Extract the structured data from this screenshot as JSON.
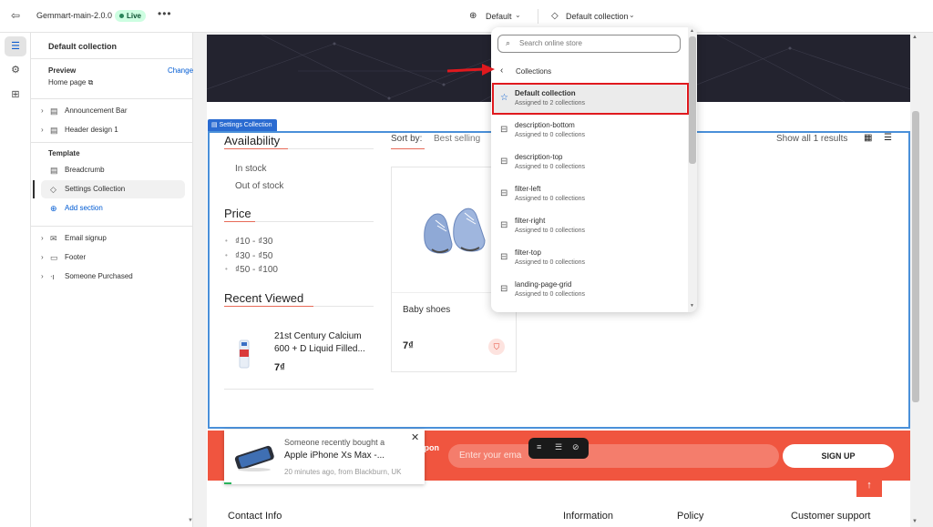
{
  "topbar": {
    "theme_name": "Gemmart-main-2.0.0",
    "status": "Live",
    "more": "•••",
    "language": "Default",
    "template": "Default collection"
  },
  "sidebar": {
    "heading": "Default collection",
    "preview_label": "Preview",
    "change_link": "Change",
    "preview_page": "Home page",
    "header_items": [
      {
        "label": "Announcement Bar",
        "icon": "layout-icon"
      },
      {
        "label": "Header design 1",
        "icon": "layout-icon"
      }
    ],
    "template_label": "Template",
    "template_items": [
      {
        "label": "Breadcrumb",
        "icon": "layout-icon"
      },
      {
        "label": "Settings Collection",
        "icon": "tag-icon"
      }
    ],
    "add_section": "Add section",
    "footer_items": [
      {
        "label": "Email signup",
        "icon": "mail-icon"
      },
      {
        "label": "Footer",
        "icon": "footer-icon"
      },
      {
        "label": "Someone Purchased",
        "icon": "app-icon"
      }
    ]
  },
  "preview": {
    "selected_label": "Settings Collection",
    "availability_title": "Availability",
    "availability_options": [
      "In stock",
      "Out of stock"
    ],
    "price_title": "Price",
    "price_options": [
      "₫10 - ₫30",
      "₫30 - ₫50",
      "₫50 - ₫100"
    ],
    "recent_title": "Recent Viewed",
    "recent_item": {
      "title_line1": "21st Century Calcium",
      "title_line2": "600 + D Liquid Filled...",
      "price": "7₫"
    },
    "sort_by_label": "Sort by:",
    "sort_by_value": "Best selling",
    "show_all": "Show all 1 results",
    "product": {
      "title": "Baby shoes",
      "price": "7₫"
    },
    "coupon_text": "upon",
    "email_placeholder": "Enter your ema",
    "signup_button": "SIGN UP",
    "footer_headings": [
      "Contact Info",
      "Information",
      "Policy",
      "Customer support"
    ]
  },
  "notification": {
    "line1": "Someone recently bought a",
    "line2": "Apple iPhone Xs Max -...",
    "line3": "20 minutes ago, from Blackburn, UK"
  },
  "dropdown": {
    "search_placeholder": "Search online store",
    "section_title": "Collections",
    "items": [
      {
        "name": "Default collection",
        "assigned": "Assigned to 2 collections",
        "icon": "star-icon",
        "active": true
      },
      {
        "name": "description-bottom",
        "assigned": "Assigned to 0 collections",
        "icon": "template-icon",
        "active": false
      },
      {
        "name": "description-top",
        "assigned": "Assigned to 0 collections",
        "icon": "template-icon",
        "active": false
      },
      {
        "name": "filter-left",
        "assigned": "Assigned to 0 collections",
        "icon": "template-icon",
        "active": false
      },
      {
        "name": "filter-right",
        "assigned": "Assigned to 0 collections",
        "icon": "template-icon",
        "active": false
      },
      {
        "name": "filter-top",
        "assigned": "Assigned to 0 collections",
        "icon": "template-icon",
        "active": false
      },
      {
        "name": "landing-page-grid",
        "assigned": "Assigned to 0 collections",
        "icon": "template-icon",
        "active": false
      }
    ]
  },
  "colors": {
    "accent": "#005bd3",
    "highlight": "#e0191e",
    "brand_orange": "#f0553f",
    "selection": "#4a90d9"
  }
}
